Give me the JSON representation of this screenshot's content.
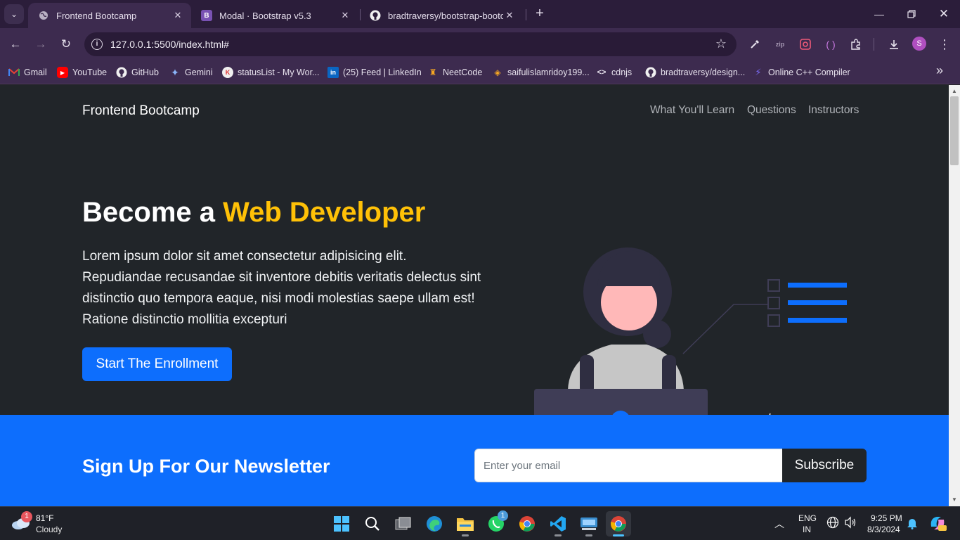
{
  "browser": {
    "tabs": [
      {
        "title": "Frontend Bootcamp",
        "favicon": "globe-icon",
        "active": true
      },
      {
        "title": "Modal · Bootstrap v5.3",
        "favicon": "bootstrap-icon",
        "active": false
      },
      {
        "title": "bradtraversy/bootstrap-bootcamp",
        "favicon": "github-icon",
        "active": false
      }
    ],
    "url": "127.0.0.1:5500/index.html#",
    "bookmarks": [
      {
        "label": "Gmail",
        "icon": "gmail-icon"
      },
      {
        "label": "YouTube",
        "icon": "youtube-icon"
      },
      {
        "label": "GitHub",
        "icon": "github-icon"
      },
      {
        "label": "Gemini",
        "icon": "gemini-icon"
      },
      {
        "label": "statusList - My Wor...",
        "icon": "codeforces-icon"
      },
      {
        "label": "(25) Feed | LinkedIn",
        "icon": "linkedin-icon"
      },
      {
        "label": "NeetCode",
        "icon": "neetcode-icon"
      },
      {
        "label": "saifulislamridoy199...",
        "icon": "profile-icon"
      },
      {
        "label": "cdnjs",
        "icon": "code-icon"
      },
      {
        "label": "bradtraversy/design...",
        "icon": "github-icon"
      },
      {
        "label": "Online C++ Compiler",
        "icon": "compiler-icon"
      }
    ],
    "profile_initial": "S"
  },
  "site": {
    "brand": "Frontend Bootcamp",
    "nav": [
      "What You'll Learn",
      "Questions",
      "Instructors"
    ],
    "hero": {
      "title_prefix": "Become a ",
      "title_accent": "Web Developer",
      "lead": "Lorem ipsum dolor sit amet consectetur adipisicing elit. Repudiandae recusandae sit inventore debitis veritatis delectus sint distinctio quo tempora eaque, nisi modi molestias saepe ullam est! Ratione distinctio mollitia excepturi",
      "cta": "Start The Enrollment"
    },
    "newsletter": {
      "heading": "Sign Up For Our Newsletter",
      "email_placeholder": "Enter your email",
      "email_value": "",
      "button": "Subscribe"
    }
  },
  "taskbar": {
    "weather": {
      "temp": "81°F",
      "condition": "Cloudy",
      "badge": "1"
    },
    "language": {
      "line1": "ENG",
      "line2": "IN"
    },
    "clock": {
      "time": "9:25 PM",
      "date": "8/3/2024"
    },
    "whatsapp_badge": "1"
  },
  "colors": {
    "accent_yellow": "#ffc107",
    "primary_blue": "#0d6efd",
    "dark": "#212529"
  }
}
